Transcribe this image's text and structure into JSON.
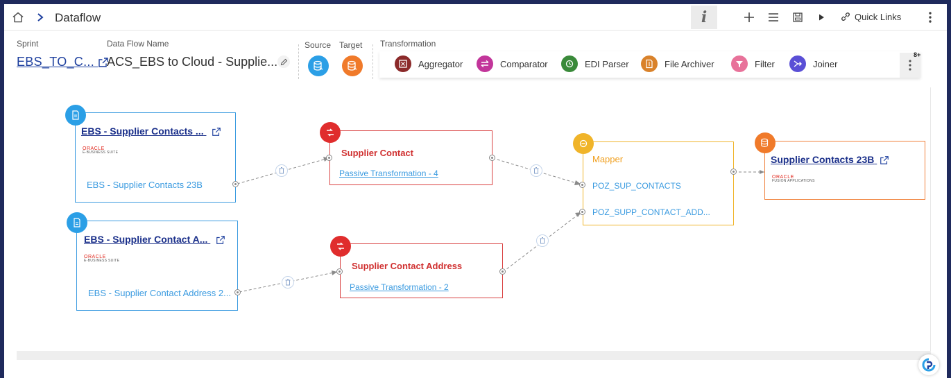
{
  "topbar": {
    "title": "Dataflow",
    "info_label": "i",
    "quick_links_label": "Quick Links"
  },
  "header": {
    "sprint_label": "Sprint",
    "sprint_value": "EBS_TO_C...",
    "flow_name_label": "Data Flow Name",
    "flow_name_value": "ACS_EBS to Cloud - Supplie...",
    "source_label": "Source",
    "target_label": "Target",
    "transformation_label": "Transformation"
  },
  "transformations": [
    {
      "label": "Aggregator",
      "color": "#8b2a2a",
      "icon": "aggregator-icon"
    },
    {
      "label": "Comparator",
      "color": "#c2359a",
      "icon": "comparator-icon"
    },
    {
      "label": "EDI Parser",
      "color": "#3a8a3a",
      "icon": "edi-parser-icon"
    },
    {
      "label": "File Archiver",
      "color": "#d9822b",
      "icon": "file-archiver-icon"
    },
    {
      "label": "Filter",
      "color": "#e8729a",
      "icon": "filter-icon"
    },
    {
      "label": "Joiner",
      "color": "#5a4fd6",
      "icon": "joiner-icon"
    }
  ],
  "more_count": "8+",
  "colors": {
    "source": "#2b9fe6",
    "target": "#f07a2a",
    "transform": "#e02d2d",
    "mapper": "#f0b429",
    "link": "#1d3f9e",
    "frame": "#1f2a5c"
  },
  "nodes": {
    "source1": {
      "title": "EBS - Supplier Contacts ...",
      "logo_line1": "ORACLE",
      "logo_line2": "E-BUSINESS SUITE",
      "output": "EBS - Supplier Contacts 23B"
    },
    "source2": {
      "title": "EBS - Supplier Contact A...",
      "logo_line1": "ORACLE",
      "logo_line2": "E-BUSINESS SUITE",
      "output": "EBS - Supplier Contact Address 2..."
    },
    "transform1": {
      "title": "Supplier Contact",
      "link": "Passive Transformation - 4"
    },
    "transform2": {
      "title": "Supplier Contact Address",
      "link": "Passive Transformation - 2"
    },
    "mapper": {
      "title": "Mapper",
      "fields": [
        "POZ_SUP_CONTACTS",
        "POZ_SUPP_CONTACT_ADD..."
      ]
    },
    "target": {
      "title": "Supplier Contacts 23B",
      "logo_line1": "ORACLE",
      "logo_line2": "FUSION APPLICATIONS"
    }
  }
}
